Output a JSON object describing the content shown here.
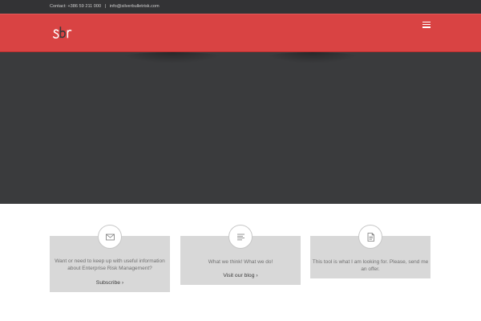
{
  "topbar": {
    "contact_label": "Contact:",
    "phone": "+386 59 211 000",
    "separator": "|",
    "email": "info@silverbulletrisk.com"
  },
  "header": {
    "logo_text": "sbr",
    "menu_icon": "hamburger-menu-icon"
  },
  "colors": {
    "topbar_bg": "#333335",
    "header_bg": "#d94343",
    "hero_bg": "#3a3b3d",
    "card_bg": "#d8d8d8"
  },
  "cards": [
    {
      "icon": "envelope-icon",
      "text": "Want or need to keep up with useful information about Enterprise Risk Management?",
      "link": "Subscribe ›"
    },
    {
      "icon": "text-lines-icon",
      "text": "What we think! What we do!",
      "link": "Visit our blog ›"
    },
    {
      "icon": "document-icon",
      "text": "This tool is what I am looking for. Please, send me an offer."
    }
  ]
}
